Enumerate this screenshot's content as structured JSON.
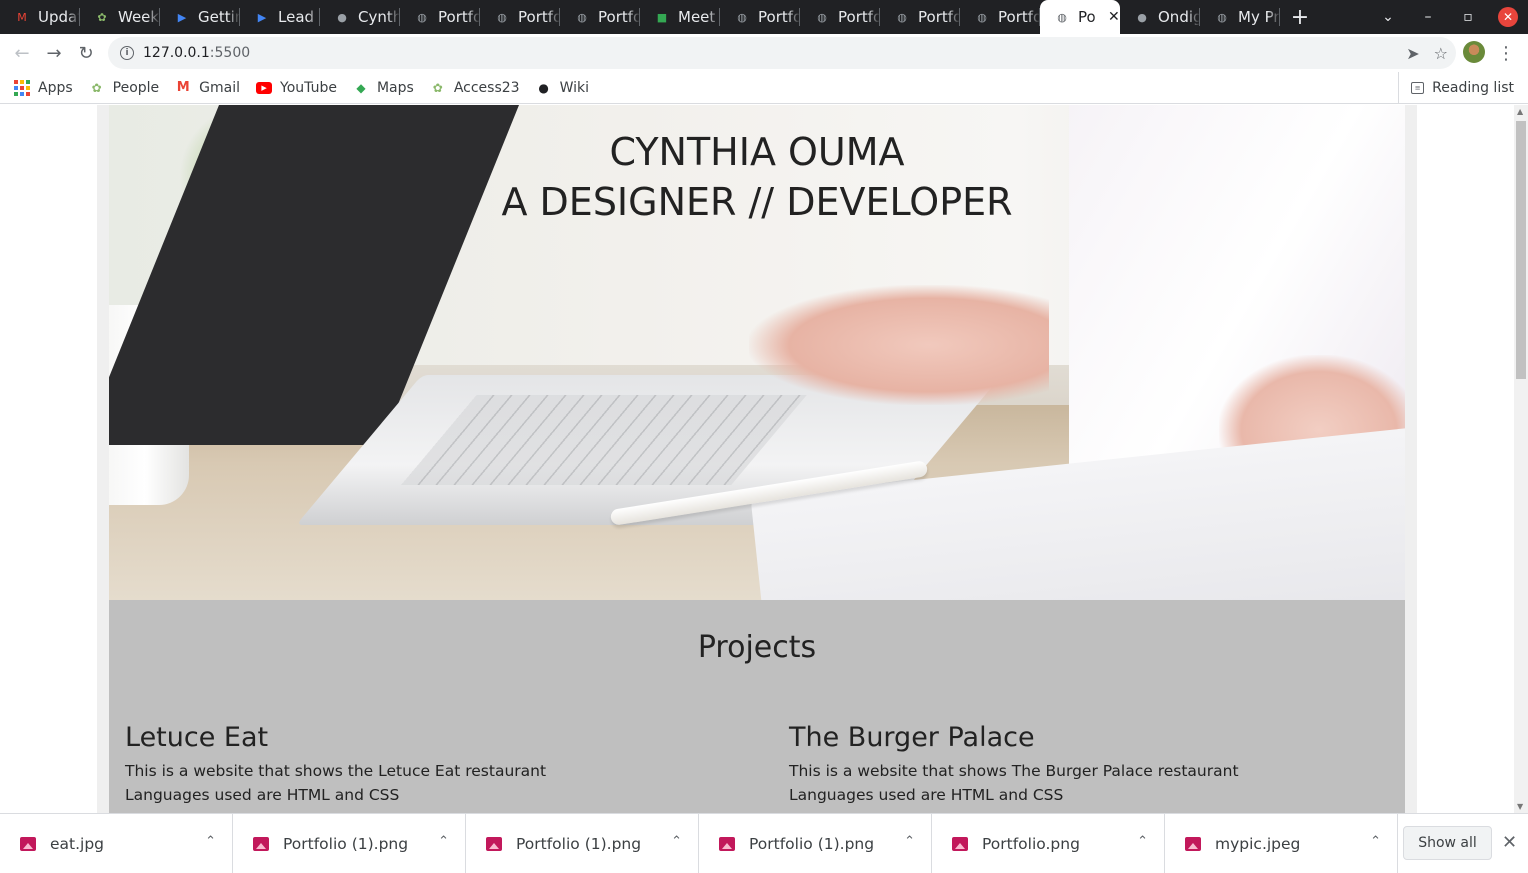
{
  "tabs": [
    {
      "title": "Updat",
      "icon": "gmail-icon",
      "color": "#ea4335",
      "glyph": "M"
    },
    {
      "title": "Week",
      "icon": "people-icon",
      "color": "#8ab86a",
      "glyph": "✿"
    },
    {
      "title": "Gettin",
      "icon": "slides-icon",
      "color": "#4285f4",
      "glyph": "▶"
    },
    {
      "title": "Lead y",
      "icon": "slides-icon",
      "color": "#4285f4",
      "glyph": "▶"
    },
    {
      "title": "Cynth",
      "icon": "github-icon",
      "color": "#9aa0a6",
      "glyph": "●"
    },
    {
      "title": "Portfo",
      "icon": "globe-icon",
      "color": "#9aa0a6",
      "glyph": "◍"
    },
    {
      "title": "Portfo",
      "icon": "globe-icon",
      "color": "#9aa0a6",
      "glyph": "◍"
    },
    {
      "title": "Portfo",
      "icon": "globe-icon",
      "color": "#9aa0a6",
      "glyph": "◍"
    },
    {
      "title": "Meet",
      "icon": "meet-icon",
      "color": "#34a853",
      "glyph": "■"
    },
    {
      "title": "Portfo",
      "icon": "globe-icon",
      "color": "#9aa0a6",
      "glyph": "◍"
    },
    {
      "title": "Portfo",
      "icon": "globe-icon",
      "color": "#9aa0a6",
      "glyph": "◍"
    },
    {
      "title": "Portfo",
      "icon": "globe-icon",
      "color": "#9aa0a6",
      "glyph": "◍"
    },
    {
      "title": "Portfo",
      "icon": "globe-icon",
      "color": "#9aa0a6",
      "glyph": "◍"
    },
    {
      "title": "Po",
      "icon": "globe-icon",
      "color": "#5f6368",
      "glyph": "◍",
      "active": true
    },
    {
      "title": "Ondig",
      "icon": "github-icon",
      "color": "#9aa0a6",
      "glyph": "●"
    },
    {
      "title": "My Pr",
      "icon": "globe-icon",
      "color": "#9aa0a6",
      "glyph": "◍"
    }
  ],
  "window": {
    "new_tab": "+",
    "dropdown": "⌄",
    "minimize": "–",
    "restore": "▫",
    "close": "✕"
  },
  "address_bar": {
    "host": "127.0.0.1",
    "port": ":5500"
  },
  "nav": {
    "back": "←",
    "forward": "→",
    "reload": "↻",
    "info": "i",
    "send_icon": "➤",
    "star_icon": "☆",
    "menu": "⋮"
  },
  "bookmarks": [
    {
      "label": "Apps",
      "icon": "apps-grid-icon"
    },
    {
      "label": "People",
      "icon": "people-icon"
    },
    {
      "label": "Gmail",
      "icon": "gmail-icon"
    },
    {
      "label": "YouTube",
      "icon": "youtube-icon"
    },
    {
      "label": "Maps",
      "icon": "maps-icon"
    },
    {
      "label": "Access23",
      "icon": "people-icon"
    },
    {
      "label": "Wiki",
      "icon": "github-icon"
    }
  ],
  "reading_list": "Reading list",
  "hero": {
    "name": "CYNTHIA OUMA",
    "tagline": "A DESIGNER // DEVELOPER"
  },
  "projects": {
    "heading": "Projects",
    "items": [
      {
        "title": "Letuce Eat",
        "description": "This is a website that shows the Letuce Eat restaurant",
        "languages": "Languages used are HTML and CSS"
      },
      {
        "title": "The Burger Palace",
        "description": "This is a website that shows The Burger Palace restaurant",
        "languages": "Languages used are HTML and CSS"
      }
    ]
  },
  "downloads": {
    "items": [
      "eat.jpg",
      "Portfolio (1).png",
      "Portfolio (1).png",
      "Portfolio (1).png",
      "Portfolio.png",
      "mypic.jpeg"
    ],
    "show_all": "Show all",
    "close": "✕",
    "chevron": "⌃"
  },
  "colors": {
    "tabstrip": "#202124",
    "projects_bg": "#bfbfbf",
    "text_dark": "#222222"
  }
}
